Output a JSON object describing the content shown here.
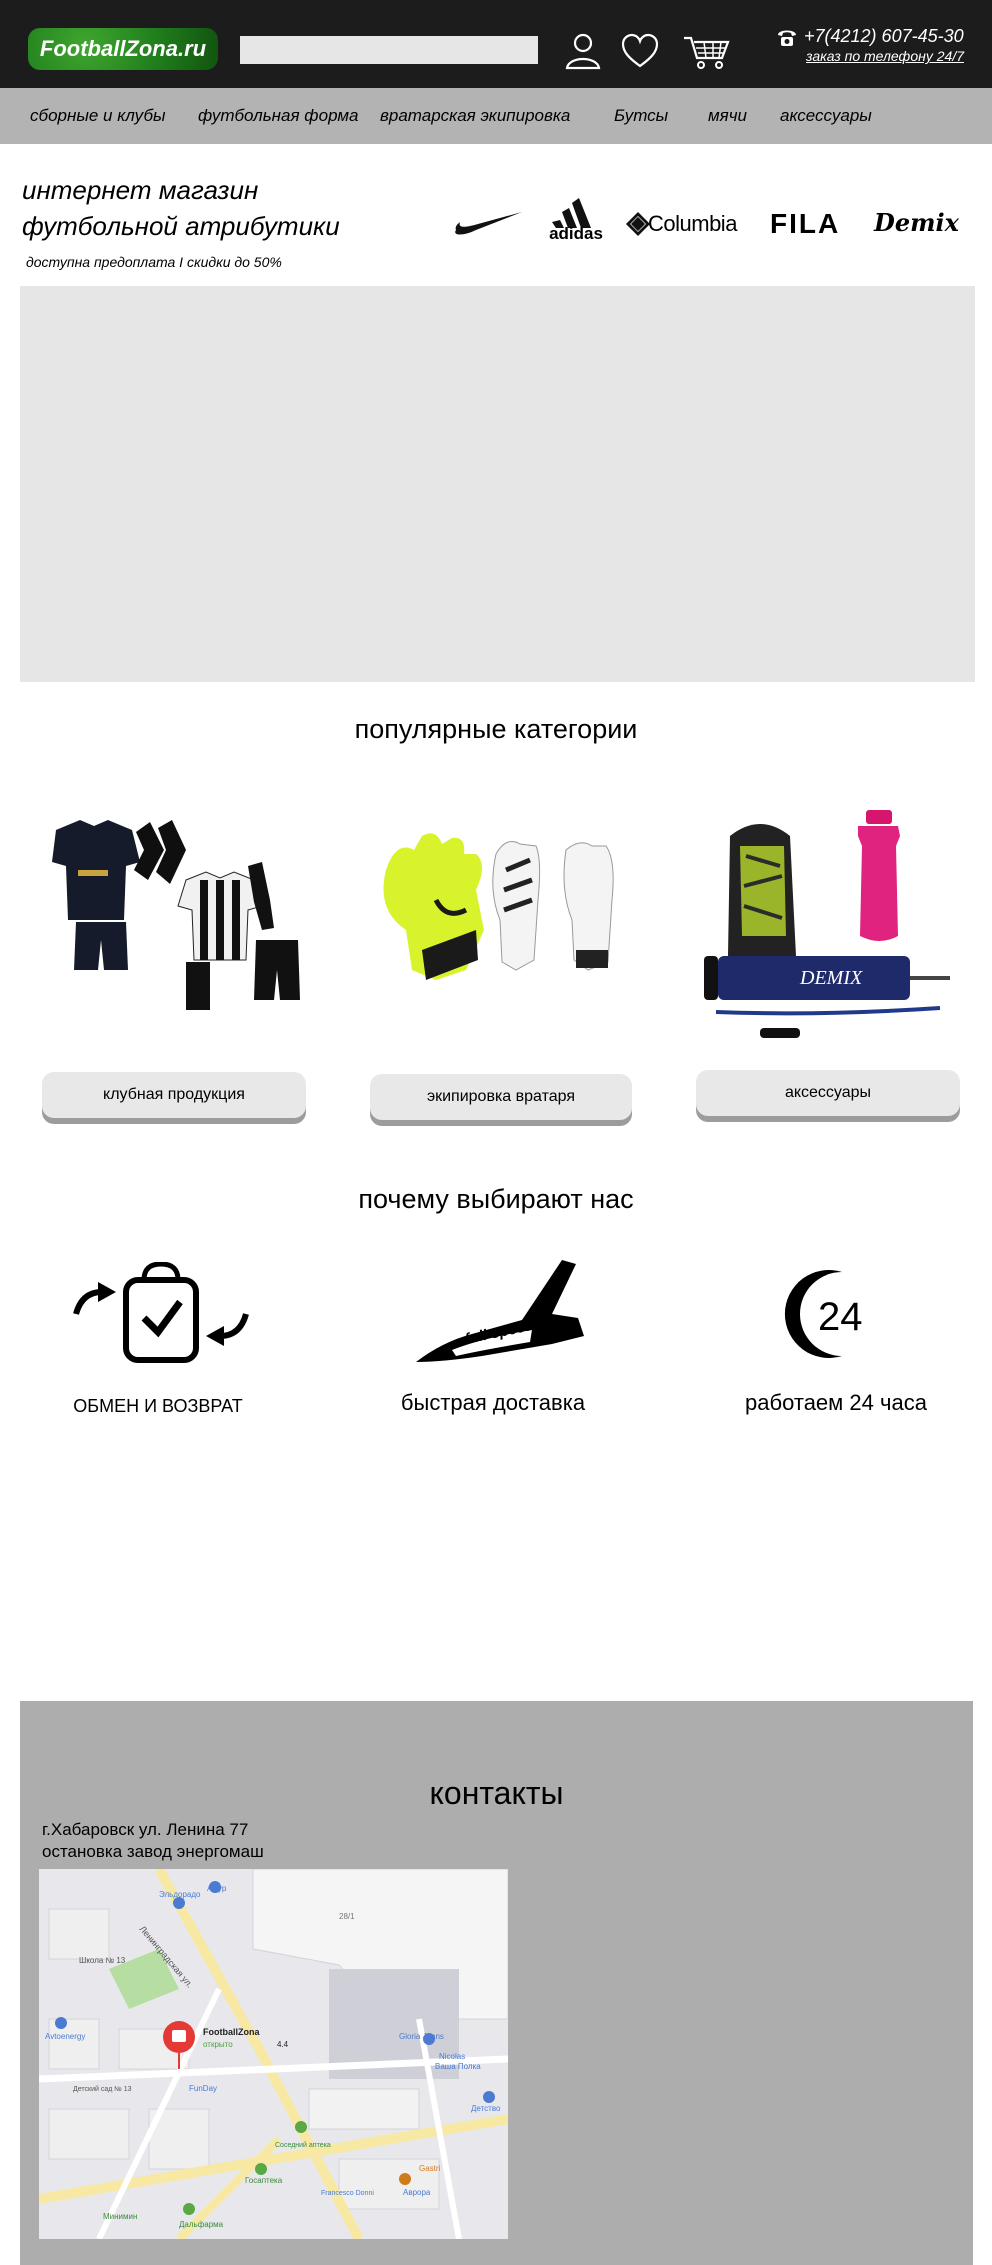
{
  "header": {
    "logo": "FootballZona.ru",
    "search_placeholder": "",
    "phone": "+7(4212) 607-45-30",
    "order_link": "заказ по телефону 24/7"
  },
  "nav": {
    "items": [
      {
        "label": "сборные и клубы"
      },
      {
        "label": "футбольная форма"
      },
      {
        "label": "вратарская экипировка"
      },
      {
        "label": "Бутсы"
      },
      {
        "label": "мячи"
      },
      {
        "label": "аксессуары"
      }
    ]
  },
  "hero": {
    "title_line1": "интернет магазин",
    "title_line2": "футбольной атрибутики",
    "subtitle": "доступна предоплата I скидки до 50%"
  },
  "brands": {
    "adidas": "adidas",
    "columbia": "Columbia",
    "fila": "FILA",
    "demix": "Demix"
  },
  "categories": {
    "title": "популярные категории",
    "items": [
      {
        "label": "клубная продукция",
        "icon": "club-kit-image"
      },
      {
        "label": "экипировка вратаря",
        "icon": "goalkeeper-gloves-image"
      },
      {
        "label": "аксессуары",
        "icon": "accessories-image"
      }
    ]
  },
  "why": {
    "title": "почему  выбирают нас",
    "items": [
      {
        "label": "ОБМЕН И ВОЗВРАТ",
        "icon": "exchange-icon"
      },
      {
        "label": "быстрая доставка",
        "icon": "shuttle-icon",
        "badge": "full speed"
      },
      {
        "label": "работаем 24 часа",
        "icon": "clock-24-icon",
        "badge": "24"
      }
    ]
  },
  "contacts": {
    "title": "контакты",
    "address_line1": "г.Хабаровск ул. Ленина 77",
    "address_line2": "остановка завод энергомаш"
  },
  "map": {
    "place_name": "FootballZona",
    "place_status": "открыто",
    "rating": "4.4",
    "street": "Ленинградская ул.",
    "labels": [
      "Эльдорадо",
      "Амур",
      "28/1",
      "Школа № 13",
      "Avtoenergy",
      "Детский сад № 13",
      "FunDay",
      "Gloria Jeans",
      "Nicolas",
      "Ваша Полка",
      "Детство",
      "Соседний аптека",
      "Госаптека",
      "Francesco Donni",
      "Дальфарма",
      "Минимин",
      "Gastri",
      "Аврора"
    ]
  },
  "colors": {
    "header_bg": "#1c1c1c",
    "nav_bg": "#b3b3b3",
    "banner_bg": "#e6e6e6",
    "logo_green": "#2e8b22",
    "contacts_bg": "#adadad"
  }
}
